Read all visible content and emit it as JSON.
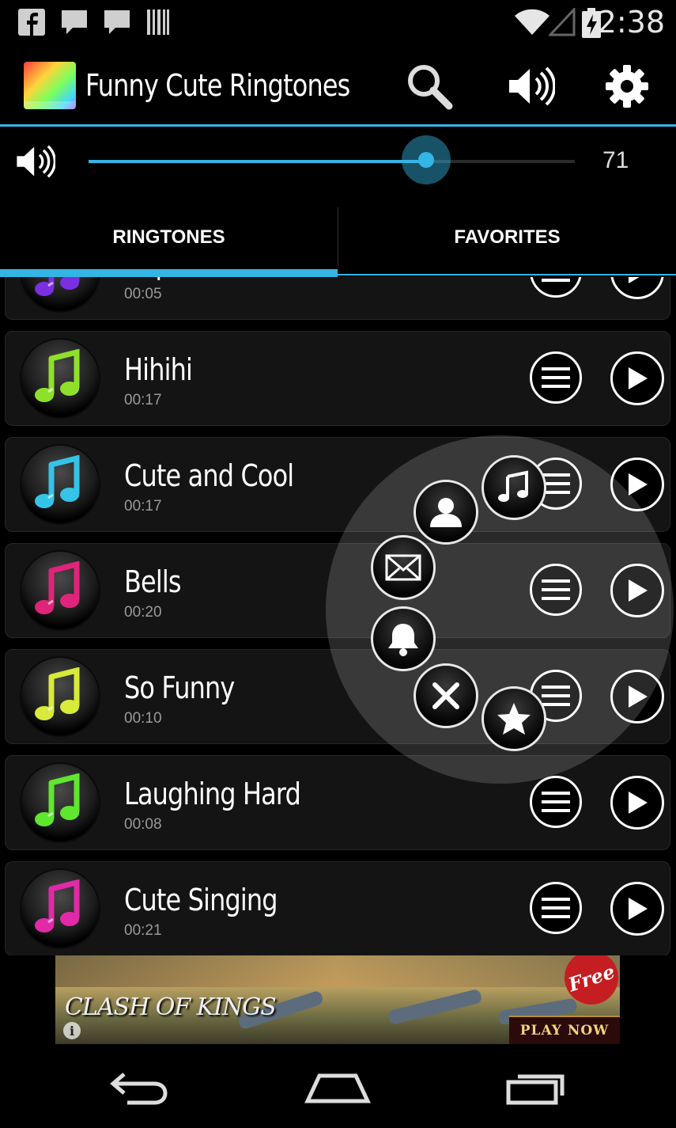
{
  "status_bar": {
    "time": "2:38",
    "icons": [
      "facebook-icon",
      "chat-icon",
      "chat-icon",
      "barcode-icon",
      "wifi-icon",
      "signal-icon",
      "battery-charging-icon"
    ]
  },
  "action_bar": {
    "title": "Funny Cute Ringtones",
    "actions": [
      "search-icon",
      "volume-icon",
      "gear-icon"
    ]
  },
  "volume": {
    "value": "71",
    "level": 71,
    "max": 100
  },
  "tabs": [
    {
      "label": "RINGTONES",
      "selected": true
    },
    {
      "label": "FAVORITES",
      "selected": false
    }
  ],
  "ringtones": [
    {
      "title": "Rap",
      "duration": "00:05",
      "note_color": "#7a2fe0"
    },
    {
      "title": "Hihihi",
      "duration": "00:17",
      "note_color": "#8fe02a"
    },
    {
      "title": "Cute and Cool",
      "duration": "00:17",
      "note_color": "#35c4e8"
    },
    {
      "title": "Bells",
      "duration": "00:20",
      "note_color": "#e0247a"
    },
    {
      "title": "So Funny",
      "duration": "00:10",
      "note_color": "#d8ea3a"
    },
    {
      "title": "Laughing Hard",
      "duration": "00:08",
      "note_color": "#5fe62e"
    },
    {
      "title": "Cute Singing",
      "duration": "00:21",
      "note_color": "#e02aa8"
    }
  ],
  "radial_menu": {
    "items": [
      "music-note-icon",
      "contact-icon",
      "envelope-icon",
      "bell-icon",
      "close-icon",
      "star-icon"
    ]
  },
  "ad": {
    "brand": "CLASH OF KINGS",
    "badge": "Free",
    "cta": "PLAY NOW",
    "info": "i"
  },
  "nav_bar": {
    "buttons": [
      "back-icon",
      "home-icon",
      "recents-icon"
    ]
  },
  "colors": {
    "accent": "#33b5e5",
    "background": "#000000",
    "row_background": "#141414"
  }
}
